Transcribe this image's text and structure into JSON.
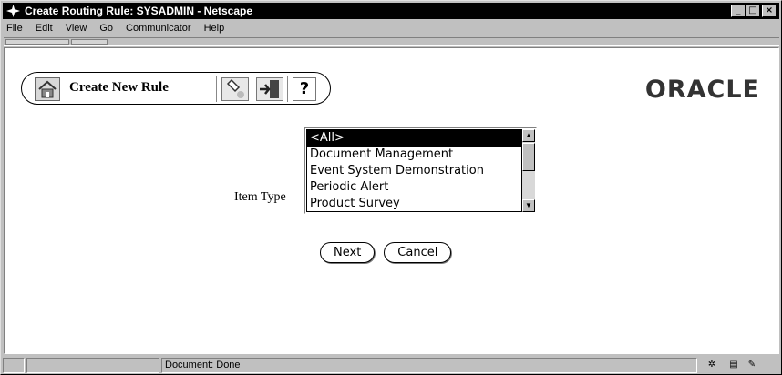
{
  "window": {
    "title": "Create Routing Rule: SYSADMIN - Netscape",
    "controls": [
      "_",
      "□",
      "×"
    ]
  },
  "menubar": {
    "items": [
      "File",
      "Edit",
      "View",
      "Go",
      "Communicator",
      "Help"
    ]
  },
  "nav": {
    "title": "Create New Rule",
    "help_glyph": "?",
    "icons": [
      "home-icon",
      "flashlight-icon",
      "exit-icon",
      "help-icon"
    ]
  },
  "logo": {
    "text": "ORACLE"
  },
  "form": {
    "item_type_label": "Item Type",
    "options": [
      "<All>",
      "Document Management",
      "Event System Demonstration",
      "Periodic Alert",
      "Product Survey"
    ],
    "selected": "<All>"
  },
  "buttons": {
    "next": "Next",
    "cancel": "Cancel"
  },
  "status": {
    "text": "Document: Done"
  }
}
